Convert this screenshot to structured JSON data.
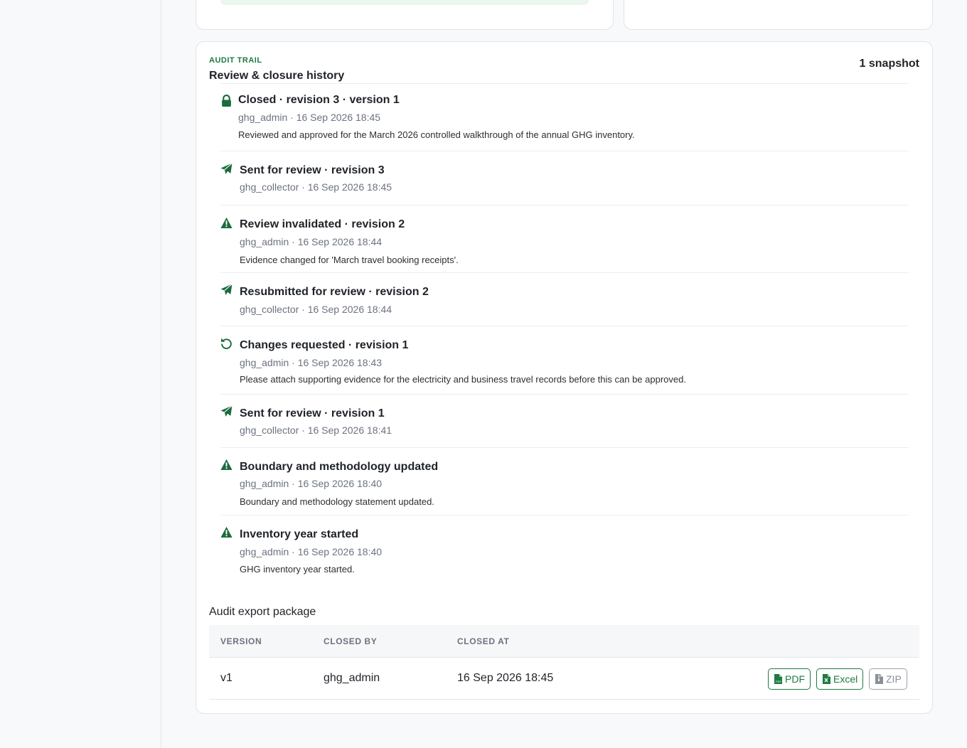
{
  "audit": {
    "eyebrow": "AUDIT TRAIL",
    "title": "Review & closure history",
    "snapshot_count": "1 snapshot",
    "events": [
      {
        "icon": "lock-icon",
        "title": "Closed · revision 3 · version 1",
        "meta": "ghg_admin · 16 Sep 2026 18:45",
        "note": "Reviewed and approved for the March 2026 controlled walkthrough of the annual GHG inventory."
      },
      {
        "icon": "send-icon",
        "title": "Sent for review · revision 3",
        "meta": "ghg_collector · 16 Sep 2026 18:45",
        "note": ""
      },
      {
        "icon": "warning-icon",
        "title": "Review invalidated · revision 2",
        "meta": "ghg_admin · 16 Sep 2026 18:44",
        "note": "Evidence changed for 'March travel booking receipts'."
      },
      {
        "icon": "send-icon",
        "title": "Resubmitted for review · revision 2",
        "meta": "ghg_collector · 16 Sep 2026 18:44",
        "note": ""
      },
      {
        "icon": "undo-icon",
        "title": "Changes requested · revision 1",
        "meta": "ghg_admin · 16 Sep 2026 18:43",
        "note": "Please attach supporting evidence for the electricity and business travel records before this can be approved."
      },
      {
        "icon": "send-icon",
        "title": "Sent for review · revision 1",
        "meta": "ghg_collector · 16 Sep 2026 18:41",
        "note": ""
      },
      {
        "icon": "warning-icon",
        "title": "Boundary and methodology updated",
        "meta": "ghg_admin · 16 Sep 2026 18:40",
        "note": "Boundary and methodology statement updated."
      },
      {
        "icon": "warning-icon",
        "title": "Inventory year started",
        "meta": "ghg_admin · 16 Sep 2026 18:40",
        "note": "GHG inventory year started."
      }
    ]
  },
  "export": {
    "title": "Audit export package",
    "columns": [
      "VERSION",
      "CLOSED BY",
      "CLOSED AT"
    ],
    "rows": [
      {
        "version": "v1",
        "closed_by": "ghg_admin",
        "closed_at": "16 Sep 2026 18:45"
      }
    ],
    "buttons": {
      "pdf": "PDF",
      "excel": "Excel",
      "zip": "ZIP"
    }
  },
  "colors": {
    "accent": "#1e7a43",
    "icon": "#1b6b3d",
    "muted": "#6b7280"
  }
}
